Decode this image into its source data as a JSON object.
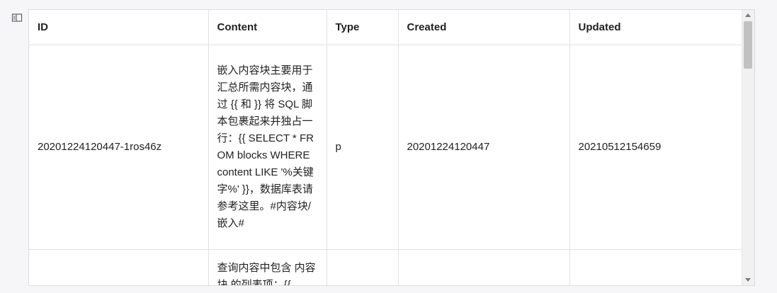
{
  "table": {
    "headers": [
      "ID",
      "Content",
      "Type",
      "Created",
      "Updated"
    ],
    "rows": [
      {
        "id": "20201224120447-1ros46z",
        "content": "嵌入内容块主要用于汇总所需内容块，通过 {{ 和 }} 将 SQL 脚本包裹起来并独占一行：{{ SELECT * FROM blocks WHERE content LIKE '%关键字%' }}，数据库表请参考这里。#内容块/嵌入#",
        "type": "p",
        "created": "20201224120447",
        "updated": "20210512154659"
      },
      {
        "id": "",
        "content": "查询内容中包含 内容块 的列表项：{{",
        "type": "",
        "created": "",
        "updated": ""
      }
    ]
  },
  "icons": {
    "sidebar_toggle": "layout-sidebar-icon"
  }
}
